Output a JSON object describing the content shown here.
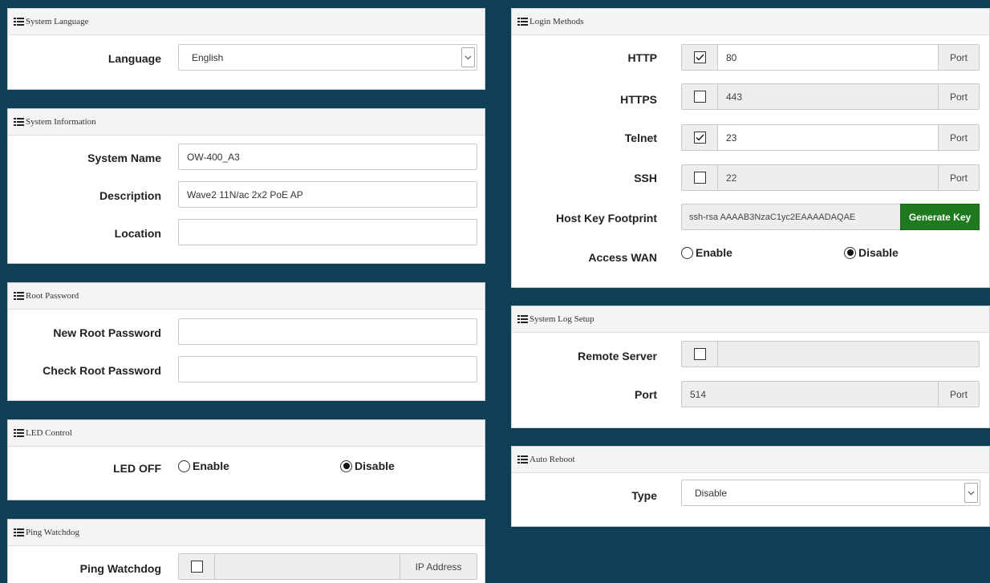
{
  "system_language": {
    "header": "System Language",
    "language_label": "Language",
    "language_value": "English"
  },
  "system_information": {
    "header": "System Information",
    "system_name_label": "System Name",
    "system_name_value": "OW-400_A3",
    "description_label": "Description",
    "description_value": "Wave2 11N/ac 2x2 PoE AP",
    "location_label": "Location",
    "location_value": ""
  },
  "root_password": {
    "header": "Root Password",
    "new_label": "New Root Password",
    "check_label": "Check Root Password"
  },
  "led_control": {
    "header": "LED Control",
    "led_off_label": "LED OFF",
    "enable_label": "Enable",
    "disable_label": "Disable",
    "selected": "Disable"
  },
  "ping_watchdog": {
    "header": "Ping Watchdog",
    "label": "Ping Watchdog",
    "checked": false,
    "addon_label": "IP Address"
  },
  "login_methods": {
    "header": "Login Methods",
    "rows": [
      {
        "label": "HTTP",
        "checked": true,
        "value": "80",
        "addon": "Port"
      },
      {
        "label": "HTTPS",
        "checked": false,
        "value": "443",
        "addon": "Port"
      },
      {
        "label": "Telnet",
        "checked": true,
        "value": "23",
        "addon": "Port"
      },
      {
        "label": "SSH",
        "checked": false,
        "value": "22",
        "addon": "Port"
      }
    ],
    "host_key_label": "Host Key Footprint",
    "host_key_value": "ssh-rsa AAAAB3NzaC1yc2EAAAADAQAE",
    "generate_key_label": "Generate Key",
    "access_wan_label": "Access WAN",
    "enable_label": "Enable",
    "disable_label": "Disable",
    "access_wan_selected": "Disable"
  },
  "system_log": {
    "header": "System Log Setup",
    "remote_server_label": "Remote Server",
    "remote_server_checked": false,
    "port_label": "Port",
    "port_value": "514",
    "port_addon": "Port"
  },
  "auto_reboot": {
    "header": "Auto Reboot",
    "type_label": "Type",
    "type_value": "Disable"
  },
  "colors": {
    "background": "#0e3f55",
    "accent_green": "#1f7a1f"
  }
}
